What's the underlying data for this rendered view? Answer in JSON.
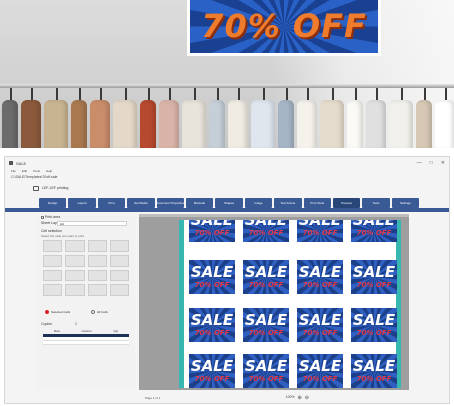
{
  "photo": {
    "banner_text": "70% OFF"
  },
  "app": {
    "title": "SALE",
    "window_controls": [
      "—",
      "□",
      "✕"
    ],
    "menu": [
      "File",
      "Edit",
      "Tools",
      "Help"
    ],
    "path": "C:\\SALE\\Templates\\70off.sale",
    "subtitle": "LEF-LEF printing",
    "tabs": [
      "Design",
      "Layout",
      "Print",
      "Set Media",
      "Document Properties",
      "Barcode",
      "Shapes",
      "Image",
      "Text Frame",
      "Print Tools",
      "Preview",
      "Tools",
      "Settings"
    ],
    "active_tab_index": 10,
    "left_panel": {
      "checkbox_label": "Print area",
      "select_label": "Sheet Layout",
      "select_value": "A4",
      "section_label": "Cell selection",
      "hint": "Select the cells you want to print",
      "radio_a": "Selected Cells",
      "radio_b": "All Cells",
      "table_label": "Copies",
      "table_value": "1",
      "table_headers": [
        "Row",
        "Column",
        "Qty"
      ]
    },
    "sale_tile": {
      "word": "SALE",
      "sub": "70% OFF"
    },
    "status": {
      "left": "Page 1 of 1",
      "zoom": "100%",
      "icons": [
        "zoom-in-icon",
        "zoom-out-icon"
      ]
    }
  }
}
